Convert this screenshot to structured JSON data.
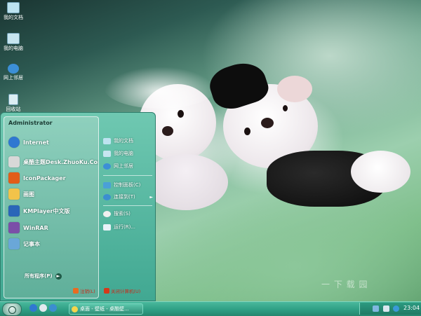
{
  "desktop": {
    "icons": [
      {
        "label": "我的文档",
        "icon": "folder-icon",
        "color": "#bde3f0"
      },
      {
        "label": "我的电脑",
        "icon": "computer-icon",
        "color": "#c7e5f0"
      },
      {
        "label": "网上邻居",
        "icon": "globe-icon",
        "color": "#3c8fd6"
      },
      {
        "label": "回收站",
        "icon": "recycle-bin-icon",
        "color": "#dceef3"
      }
    ]
  },
  "start_menu": {
    "user": "Administrator",
    "programs": [
      {
        "label": "Internet",
        "icon": "internet-explorer-icon",
        "color": "#2f78d1"
      },
      {
        "label": "桌酷主题Desk.ZhuoKu.Com",
        "icon": "theme-site-icon",
        "color": "#d8d8d8"
      },
      {
        "label": "IconPackager",
        "icon": "iconpackager-icon",
        "color": "#e25d19"
      },
      {
        "label": "画图",
        "icon": "paint-icon",
        "color": "#f2c34a"
      },
      {
        "label": "KMPlayer中文版",
        "icon": "kmplayer-icon",
        "color": "#2a66b8"
      },
      {
        "label": "WinRAR",
        "icon": "winrar-icon",
        "color": "#7b4fa8"
      },
      {
        "label": "记事本",
        "icon": "notepad-icon",
        "color": "#6aa7d8"
      }
    ],
    "all_programs": "所有程序(P)",
    "places": [
      {
        "label": "我的文档",
        "icon": "folder-icon",
        "color": "#bde3f0"
      },
      {
        "label": "我的电脑",
        "icon": "computer-icon",
        "color": "#c7e5f0"
      },
      {
        "label": "网上邻居",
        "icon": "globe-icon",
        "color": "#3c8fd6"
      }
    ],
    "system": [
      {
        "label": "控制面板(C)",
        "icon": "control-panel-icon",
        "color": "#4aa0d8",
        "submenu": false
      },
      {
        "label": "连接到(T)",
        "icon": "connect-icon",
        "color": "#3b8ed0",
        "submenu": true
      }
    ],
    "tools": [
      {
        "label": "搜索(S)",
        "icon": "search-icon",
        "color": "#f0f0f0"
      },
      {
        "label": "运行(R)...",
        "icon": "run-icon",
        "color": "#e9f2f8"
      }
    ],
    "logoff": "注销(L)",
    "shutdown": "关闭计算机(U)"
  },
  "taskbar": {
    "task_label": "桌面 - 壁纸 - 桌酷壁...",
    "clock": "23:04"
  },
  "watermark": "一 下 载 园",
  "colors": {
    "accent": "#41a892",
    "taskbar": "#2f9f84",
    "logoff_text": "#c62c1c"
  }
}
